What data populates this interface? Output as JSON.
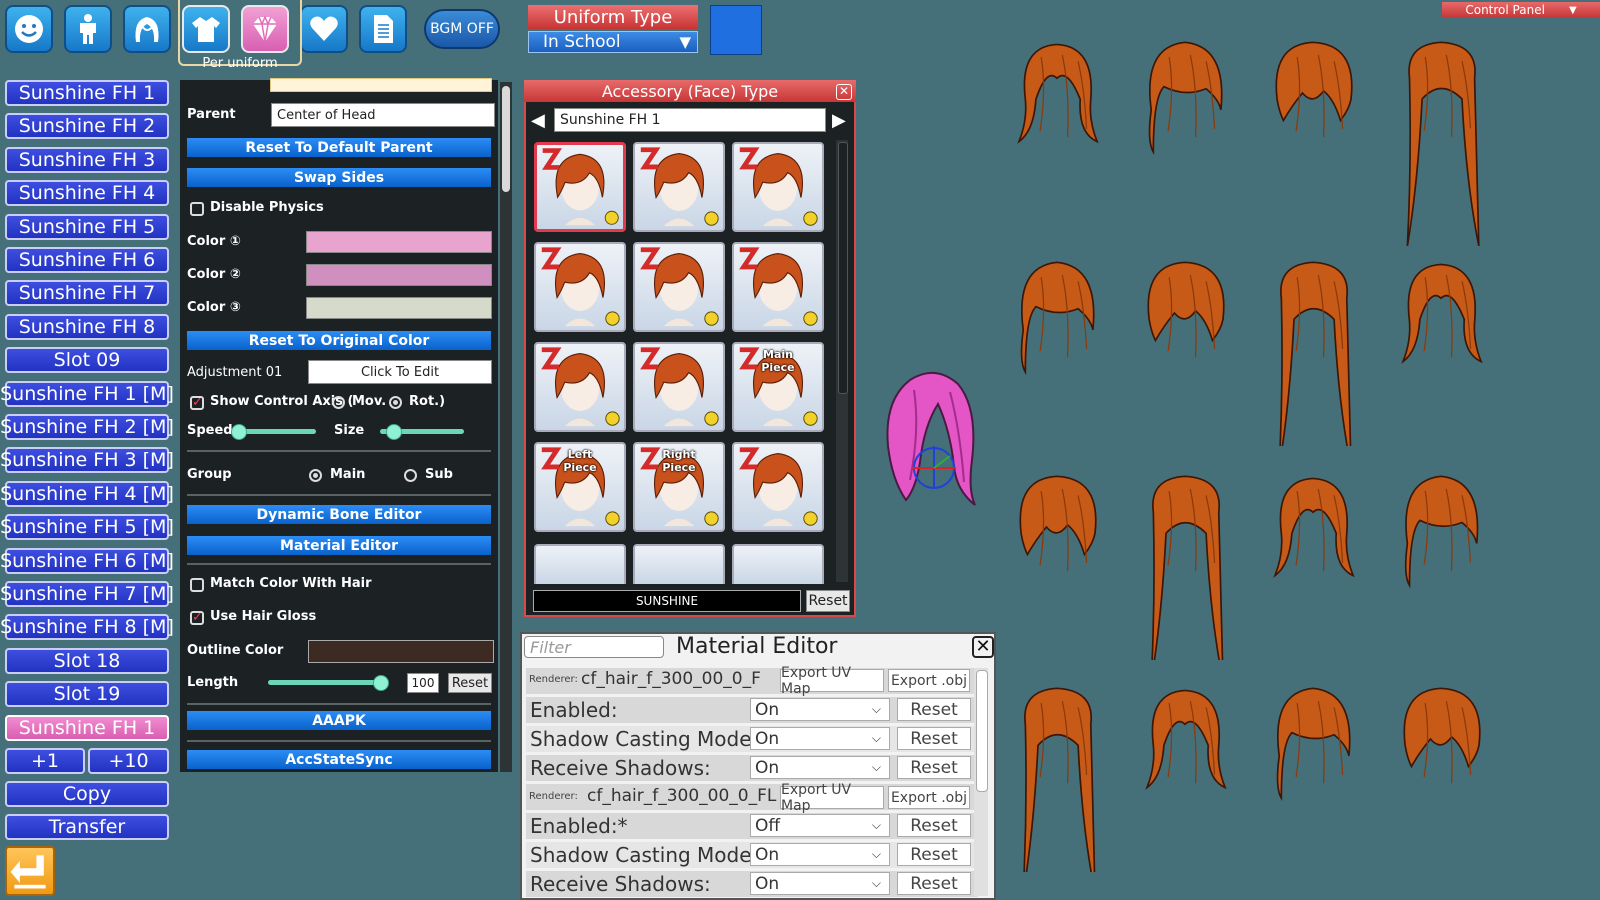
{
  "toolbar": {
    "icons": [
      "face-icon",
      "body-icon",
      "hair-icon",
      "clothing-icon",
      "accessory-icon",
      "heart-icon",
      "document-icon"
    ],
    "bgm_label": "BGM OFF",
    "per_uniform_label": "Per uniform"
  },
  "uniform": {
    "title": "Uniform Type",
    "selected": "In School",
    "accent": "#1f6fe0"
  },
  "control_panel_label": "Control Panel",
  "slots": [
    {
      "label": "Sunshine FH 1",
      "active": false
    },
    {
      "label": "Sunshine FH 2",
      "active": false
    },
    {
      "label": "Sunshine FH 3",
      "active": false
    },
    {
      "label": "Sunshine FH 4",
      "active": false
    },
    {
      "label": "Sunshine FH 5",
      "active": false
    },
    {
      "label": "Sunshine FH 6",
      "active": false
    },
    {
      "label": "Sunshine FH 7",
      "active": false
    },
    {
      "label": "Sunshine FH 8",
      "active": false
    },
    {
      "label": "Slot 09",
      "active": false
    },
    {
      "label": "Sunshine FH 1 [M]",
      "active": false
    },
    {
      "label": "Sunshine FH 2 [M]",
      "active": false
    },
    {
      "label": "Sunshine FH 3 [M]",
      "active": false
    },
    {
      "label": "Sunshine FH 4 [M]",
      "active": false
    },
    {
      "label": "Sunshine FH 5 [M]",
      "active": false
    },
    {
      "label": "Sunshine FH 6 [M]",
      "active": false
    },
    {
      "label": "Sunshine FH 7 [M]",
      "active": false
    },
    {
      "label": "Sunshine FH 8 [M]",
      "active": false
    },
    {
      "label": "Slot 18",
      "active": false
    },
    {
      "label": "Slot 19",
      "active": false
    },
    {
      "label": "Sunshine FH 1",
      "active": true
    }
  ],
  "slot_actions": {
    "plus1": "+1",
    "plus10": "+10",
    "copy": "Copy",
    "transfer": "Transfer"
  },
  "editor": {
    "parent_label": "Parent",
    "parent_value": "Center of Head",
    "reset_parent": "Reset To Default Parent",
    "swap_sides": "Swap Sides",
    "disable_physics": "Disable Physics",
    "color1_label": "Color ①",
    "color2_label": "Color ②",
    "color3_label": "Color ③",
    "color1": "#e9a3cf",
    "color2": "#cf8fbf",
    "color3": "#d6dacb",
    "reset_color": "Reset To Original Color",
    "adjustment_label": "Adjustment 01",
    "adjustment_button": "Click To Edit",
    "show_axis": "Show Control Axis (",
    "mov": "Mov.",
    "rot": "Rot.)",
    "speed_label": "Speed",
    "size_label": "Size",
    "speed_fraction": 0.05,
    "size_fraction": 0.15,
    "group_label": "Group",
    "group_main": "Main",
    "group_sub": "Sub",
    "dynamic_bone": "Dynamic Bone Editor",
    "material_editor": "Material Editor",
    "match_color": "Match Color With Hair",
    "use_gloss": "Use Hair Gloss",
    "outline_label": "Outline Color",
    "outline_color": "#3d2a22",
    "length_label": "Length",
    "length_value": "100",
    "length_fraction": 1.0,
    "length_reset": "Reset",
    "aaapk": "AAAPK",
    "accstatesync": "AccStateSync"
  },
  "accessory": {
    "title": "Accessory (Face) Type",
    "current": "Sunshine FH 1",
    "search": "SUNSHINE",
    "reset": "Reset",
    "thumbs": [
      {
        "caption": "",
        "selected": true
      },
      {
        "caption": "",
        "selected": false
      },
      {
        "caption": "",
        "selected": false
      },
      {
        "caption": "",
        "selected": false
      },
      {
        "caption": "",
        "selected": false
      },
      {
        "caption": "",
        "selected": false
      },
      {
        "caption": "",
        "selected": false
      },
      {
        "caption": "",
        "selected": false
      },
      {
        "caption": "Main\nPiece",
        "selected": false
      },
      {
        "caption": "Left\nPiece",
        "selected": false
      },
      {
        "caption": "Right\nPiece",
        "selected": false
      },
      {
        "caption": "",
        "selected": false
      }
    ]
  },
  "material_editor": {
    "filter_placeholder": "Filter",
    "title": "Material Editor",
    "renderer_tag": "Renderer:",
    "renderer1": "cf_hair_f_300_00_0_F",
    "renderer2": "cf_hair_f_300_00_0_FL",
    "export_uv": "Export UV Map",
    "export_obj": "Export .obj",
    "enabled1_label": "Enabled:",
    "enabled1_value": "On",
    "shadow1_label": "Shadow Casting Mode:",
    "shadow1_value": "On",
    "receive1_label": "Receive Shadows:",
    "receive1_value": "On",
    "enabled2_label": "Enabled:*",
    "enabled2_value": "Off",
    "shadow2_label": "Shadow Casting Mode:",
    "shadow2_value": "On",
    "receive2_label": "Receive Shadows:",
    "receive2_value": "On",
    "reset": "Reset"
  }
}
